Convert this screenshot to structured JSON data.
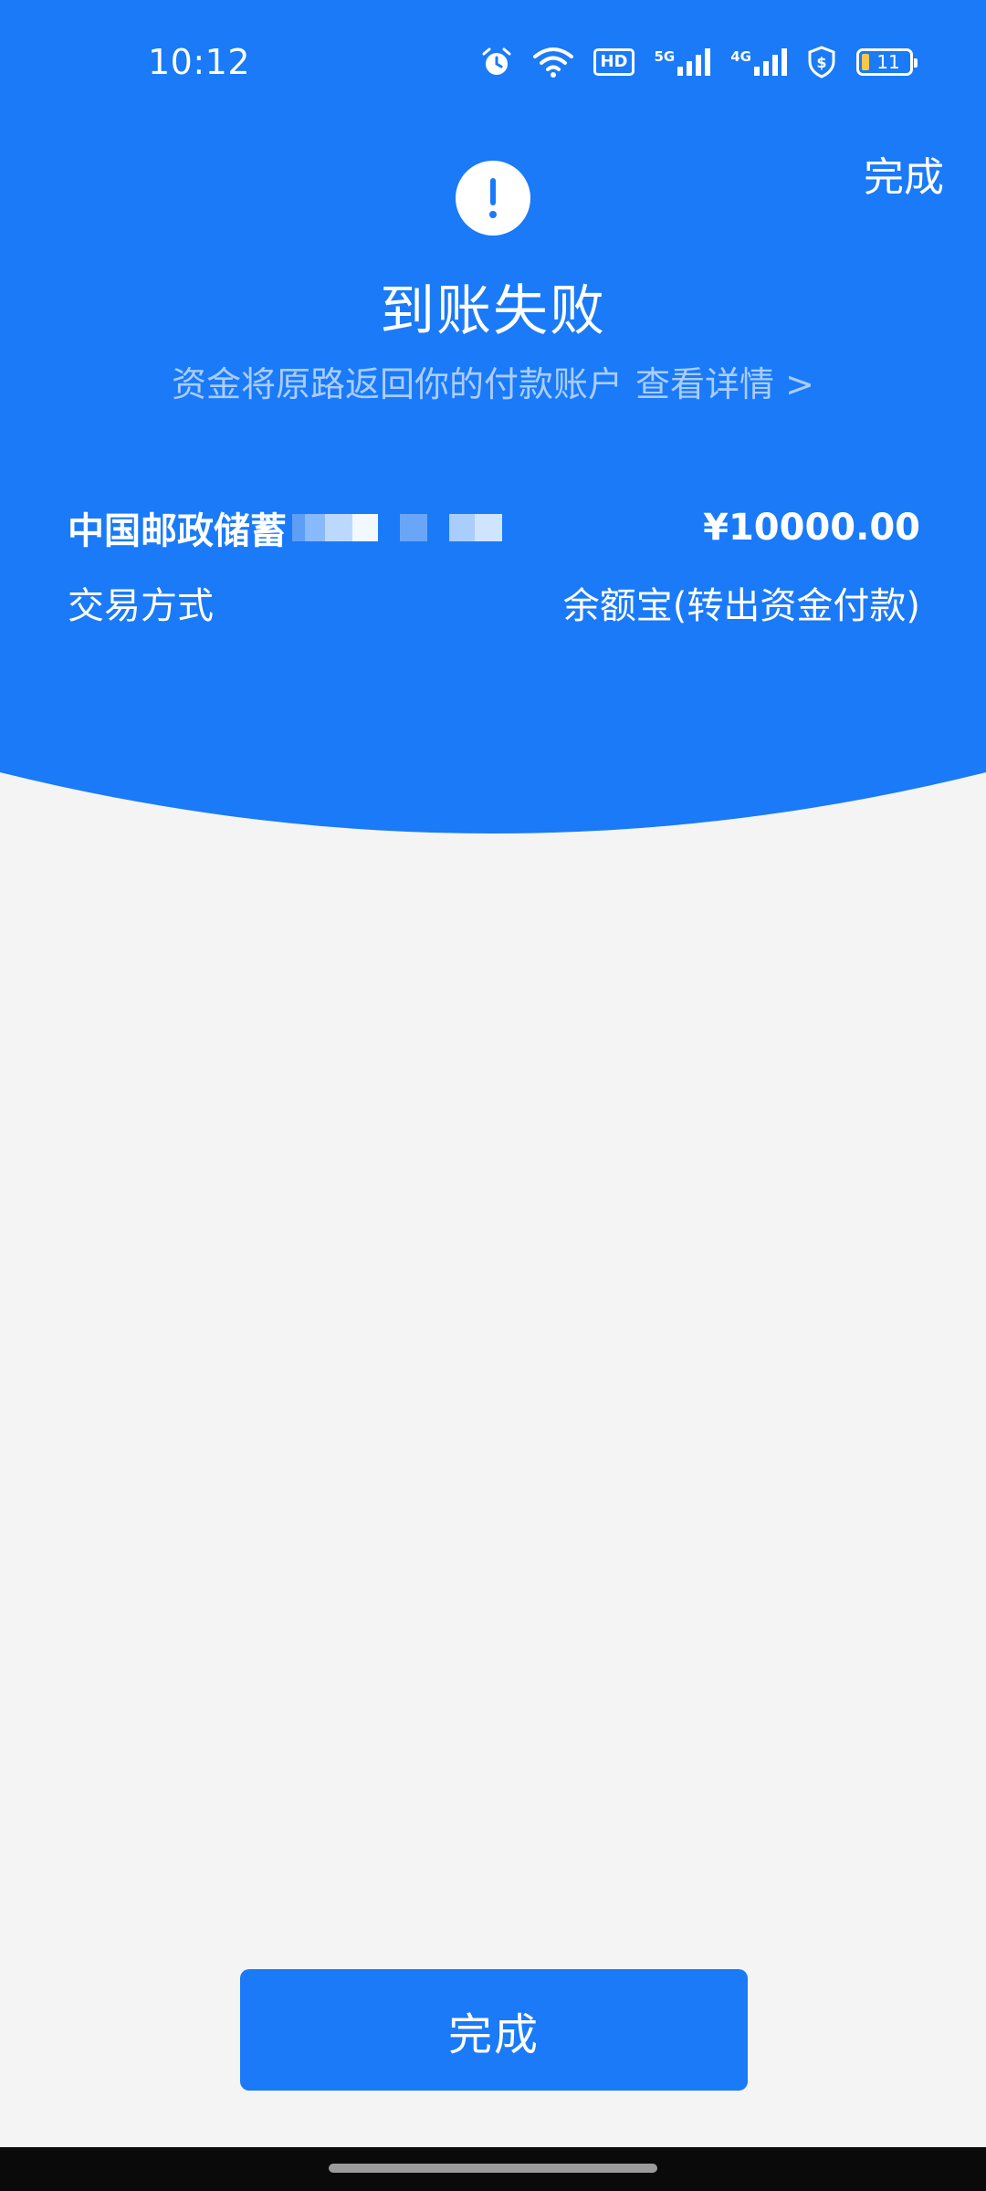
{
  "status_bar": {
    "time": "10:12",
    "network_1": "5G",
    "network_2": "4G",
    "hd_label": "HD",
    "battery": "11",
    "battery_color": "#f6c94a"
  },
  "header": {
    "done_label": "完成",
    "title": "到账失败",
    "subtitle": "资金将原路返回你的付款账户",
    "details_link": "查看详情 >"
  },
  "transaction": {
    "bank_name": "中国邮政储蓄",
    "amount": "¥10000.00",
    "method_label": "交易方式",
    "method_value": "余额宝(转出资金付款)"
  },
  "footer": {
    "done_button": "完成"
  },
  "colors": {
    "primary_blue": "#1a7af8",
    "background": "#f4f4f4",
    "subtitle": "#a9cdfd"
  },
  "icons": {
    "alert": "exclamation-circle-icon",
    "alarm": "alarm-icon",
    "wifi": "wifi-icon",
    "signal": "signal-icon",
    "shield": "shield-icon"
  }
}
